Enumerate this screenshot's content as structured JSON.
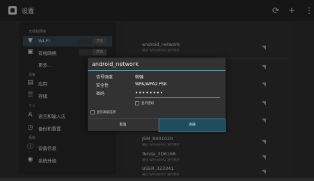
{
  "actionbar": {
    "title": "设置",
    "icons": [
      "wifi-refresh-icon",
      "add-icon",
      "overflow-menu-icon"
    ]
  },
  "sidebar": {
    "sections": [
      {
        "label": "无线和网络"
      },
      {
        "label": "设备"
      },
      {
        "label": "个人"
      },
      {
        "label": "系统"
      }
    ],
    "items": [
      {
        "label": "WI-FI",
        "icon": "wifi-icon",
        "toggle": "开启"
      },
      {
        "label": "有线网络",
        "icon": "ethernet-icon",
        "toggle": "开启"
      },
      {
        "label": "更多...",
        "icon": ""
      },
      {
        "label": "应用",
        "icon": "apps-icon"
      },
      {
        "label": "存储",
        "icon": "storage-icon"
      },
      {
        "label": "语言和输入法",
        "icon": "language-icon"
      },
      {
        "label": "备份和重置",
        "icon": "backup-icon"
      },
      {
        "label": "设备信息",
        "icon": "info-icon"
      },
      {
        "label": "系统升级",
        "icon": "update-icon"
      }
    ]
  },
  "networks": [
    {
      "name": "android_network",
      "sub": "通过 WPA/WPA2 进行保护"
    },
    {
      "name": "JSM_B001020",
      "sub": "通过 WPA/WPA2 进行保护"
    },
    {
      "name": "Tenda_3D6168",
      "sub": "通过 WPA/WPA2 进行保护"
    },
    {
      "name": "USER_323341",
      "sub": "通过 WPA/WPA2 进行保护"
    }
  ],
  "dialog": {
    "title": "android_network",
    "signal_label": "信号强度",
    "signal_value": "较强",
    "security_label": "安全性",
    "security_value": "WPA/WPA2 PSK",
    "password_label": "密码",
    "password_value": "••••••••",
    "show_password": "显示密码",
    "advanced": "显示高级选项",
    "cancel": "取消",
    "connect": "连接"
  },
  "colors": {
    "accent": "#33b5e5",
    "selected": "#33434f"
  }
}
